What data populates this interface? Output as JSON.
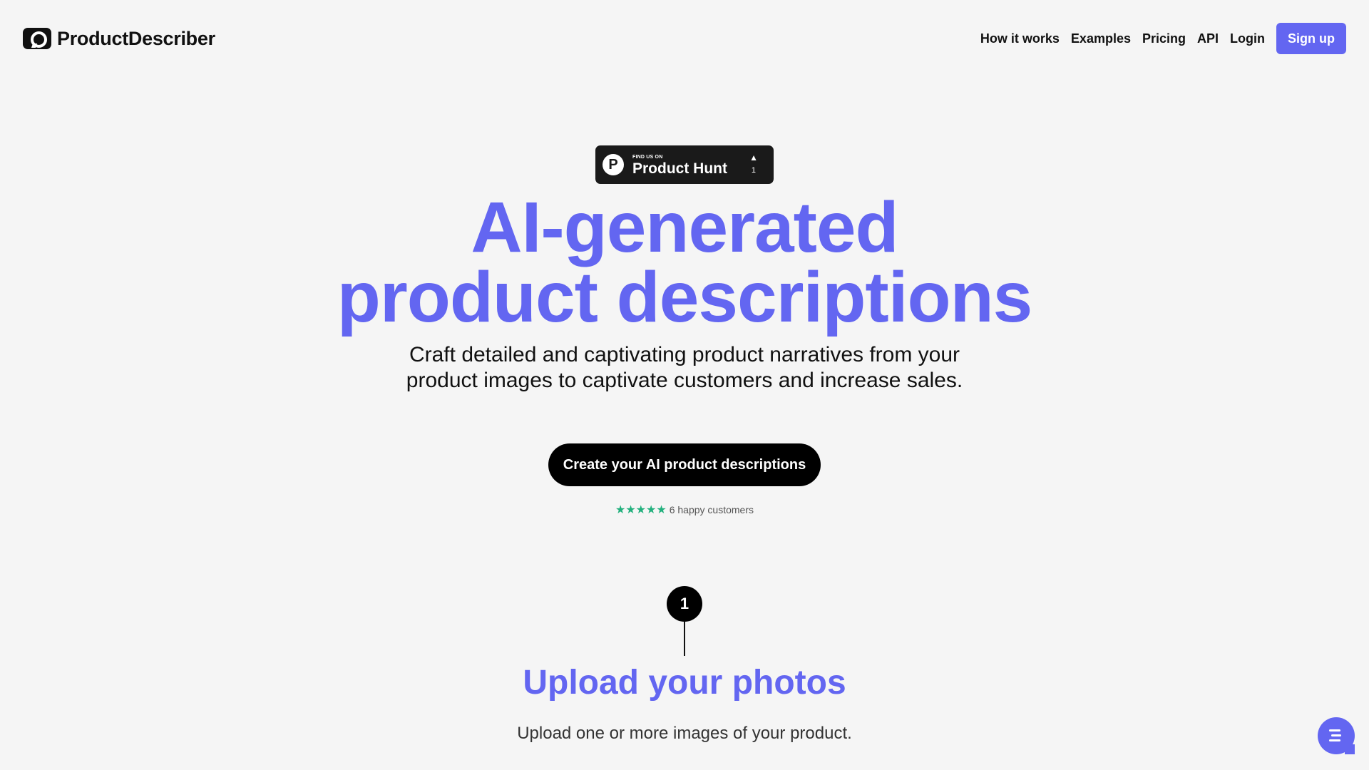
{
  "header": {
    "logo_text": "ProductDescriber",
    "nav": [
      "How it works",
      "Examples",
      "Pricing",
      "API",
      "Login"
    ],
    "signup_label": "Sign up"
  },
  "product_hunt": {
    "small": "FIND US ON",
    "big": "Product Hunt",
    "logo_letter": "P",
    "arrow": "▲",
    "count": "1"
  },
  "hero": {
    "title_line1": "AI-generated",
    "title_line2": "product descriptions",
    "subtitle": "Craft detailed and captivating product narratives from your product images to captivate customers and increase sales.",
    "cta_label": "Create your AI product descriptions",
    "stars": "★★★★★",
    "rating_text": "6 happy customers"
  },
  "step": {
    "number": "1",
    "title": "Upload your photos",
    "description": "Upload one or more images of your product."
  },
  "colors": {
    "accent": "#6366f1",
    "star": "#22b07d",
    "background": "#f5f5f5"
  },
  "icons": {
    "logo": "camera-chat-icon",
    "chat": "chat-menu-icon"
  }
}
